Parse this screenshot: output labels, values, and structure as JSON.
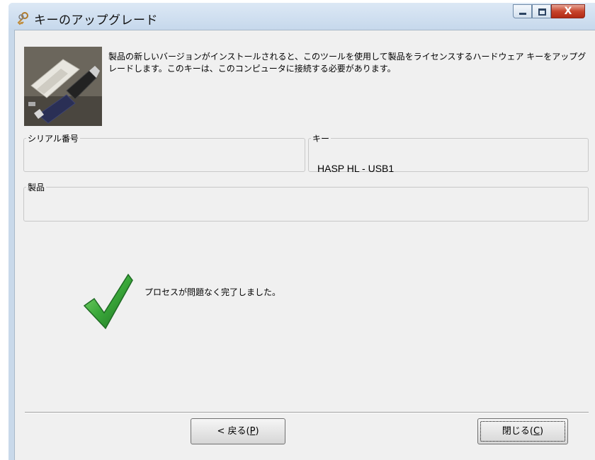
{
  "window": {
    "title": "キーのアップグレード",
    "icons": {
      "app": "keys-icon",
      "minimize": "minimize-icon",
      "maximize": "maximize-icon",
      "close": "close-icon"
    },
    "close_glyph": "X"
  },
  "description": "製品の新しいバージョンがインストールされると、このツールを使用して製品をライセンスするハードウェア キーをアップグレードします。このキーは、このコンピュータに接続する必要があります。",
  "groups": {
    "serial": {
      "label": "シリアル番号",
      "value": ""
    },
    "key": {
      "label": "キー",
      "value": "HASP HL - USB1"
    },
    "product": {
      "label": "製品",
      "value": ""
    }
  },
  "status": {
    "icon": "checkmark-icon",
    "message": "プロセスが問題なく完了しました。"
  },
  "buttons": {
    "back": {
      "prefix": "< 戻る(",
      "mnemonic": "P",
      "suffix": ")"
    },
    "close": {
      "prefix": "閉じる(",
      "mnemonic": "C",
      "suffix": ")"
    }
  },
  "colors": {
    "check_green": "#3aa83a",
    "close_button": "#c7442c"
  }
}
